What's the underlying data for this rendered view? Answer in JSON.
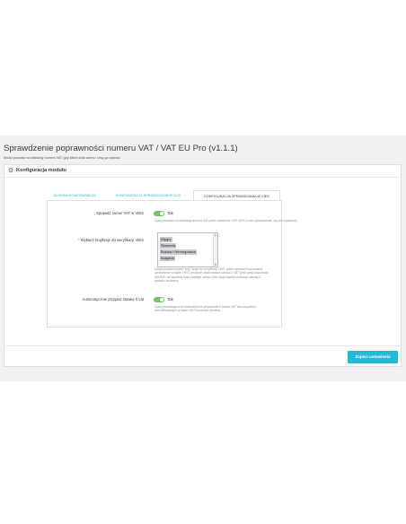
{
  "page": {
    "title": "Sprawdzenie poprawności numeru VAT / VAT EU Pro (v1.1.1)",
    "subtitle": "Moduł pozwala na walidację numeru VAT, gdy klient doda adres i chcę go zapisać"
  },
  "panel": {
    "header_icon": "gears-icon",
    "title": "Konfiguracja modułu"
  },
  "tabs": [
    {
      "label": "GŁÓWNA KONFIGURACJA",
      "active": false
    },
    {
      "label": "KONFIGURACJA SPRAWDZANIA W GUS",
      "active": false
    },
    {
      "label": "KONFIGURACJA SPRAWDZANIA W VIES",
      "active": true
    }
  ],
  "form": {
    "check_vat": {
      "label": "Sprawdź numer VAT w VIES",
      "value": "Tak",
      "help": "Opcja pozwala na walidację numeru VAT przez webservis / API VIES w celu sprawdzenia, czy jest poprawny."
    },
    "countries": {
      "required_mark": "*",
      "label": "Wybierz kraj/kraje do weryfikacji VIES",
      "options": [
        "Węgry",
        "Słowenia",
        "Bośnia i Hercegowina",
        "Bułgaria"
      ],
      "selected": [
        "Węgry",
        "Słowenia",
        "Bośnia i Hercegowina",
        "Bułgaria"
      ],
      "help": "Opcja pozwala wybrać kraj / kraje do weryfikacji VIES, gdzie wybrane kraj zostaną sprawdzone w bazie VIES i zostanie zastosowana stawka 0 VAT (jeśli opcja włączona). WAŻNE: nie wybieraj kraju swojego sklepu, jeśli opcja będzie stosować stawkę 0 podatku dostawcy."
    },
    "auto_zero": {
      "label": "Automatycznie przypisz stawkę 0 vat",
      "value": "Tak",
      "help": "Opcja pozwalająca na automatyczne przypisanie 0 stawki VAT dla wszystkich zweryfikowanych w bazie VIES numerów klientów."
    }
  },
  "footer": {
    "save_label": "Zapisz ustawienia"
  },
  "colors": {
    "accent": "#25b9d7",
    "toggle_on": "#78c16a",
    "background": "#eff1f2"
  }
}
